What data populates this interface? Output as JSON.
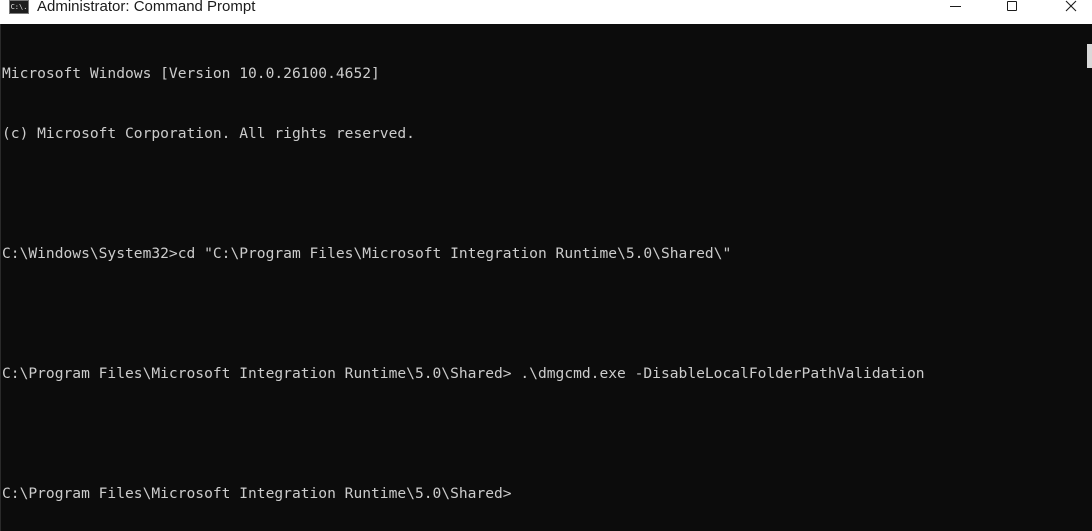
{
  "window": {
    "title": "Administrator: Command Prompt",
    "icon_label": "C:\\."
  },
  "console": {
    "lines": [
      "Microsoft Windows [Version 10.0.26100.4652]",
      "(c) Microsoft Corporation. All rights reserved.",
      "",
      "C:\\Windows\\System32>cd \"C:\\Program Files\\Microsoft Integration Runtime\\5.0\\Shared\\\"",
      "",
      "C:\\Program Files\\Microsoft Integration Runtime\\5.0\\Shared> .\\dmgcmd.exe -DisableLocalFolderPathValidation",
      "",
      "C:\\Program Files\\Microsoft Integration Runtime\\5.0\\Shared>"
    ]
  },
  "colors": {
    "background": "#0c0c0c",
    "text": "#cccccc",
    "titlebar": "#ffffff"
  },
  "icons": {
    "app": "command-prompt-icon",
    "minimize": "minimize-icon",
    "maximize": "maximize-icon",
    "close": "close-icon"
  }
}
